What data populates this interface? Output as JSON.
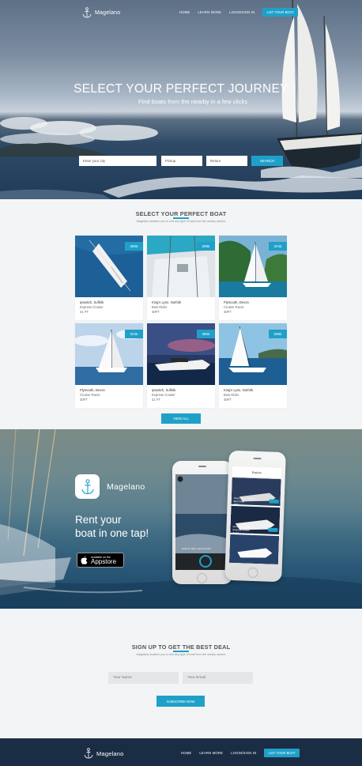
{
  "brand": {
    "name": "Magelano"
  },
  "nav": {
    "links": [
      "HOME",
      "LEARN MORE",
      "LOGIN/SIGN IN"
    ],
    "cta": "LIST YOUR BOAT"
  },
  "hero": {
    "title": "SELECT YOUR PERFECT JOURNEY",
    "subtitle": "Find boats from the nearby in a few clicks",
    "search": {
      "city_placeholder": "Enter your city",
      "pickup_placeholder": "Pickup",
      "return_placeholder": "Return",
      "button": "SEARCH"
    }
  },
  "boats_section": {
    "title": "SELECT YOUR PERFECT BOAT",
    "subtitle": "Magelano enables you to rent any type of boat from the nearby owners",
    "cards": [
      {
        "price": "450£",
        "location": "Ipswitch, Suffolk",
        "type": "Express Cruiser",
        "length": "31 FT"
      },
      {
        "price": "299£",
        "location": "King's Lynn, Norfolk",
        "type": "Bow Rider",
        "length": "30FT"
      },
      {
        "price": "224£",
        "location": "Plymouth, Devon",
        "type": "Cruiser Racer",
        "length": "30FT"
      },
      {
        "price": "224£",
        "location": "Plymouth, Devon",
        "type": "Cruiser Racer",
        "length": "30FT"
      },
      {
        "price": "450£",
        "location": "Ipswitch, Suffolk",
        "type": "Express Cruiser",
        "length": "31 FT"
      },
      {
        "price": "299£",
        "location": "King's Lynn, Norfolk",
        "type": "Bow Rider",
        "length": "30FT"
      }
    ],
    "view_all": "VIEW ALL"
  },
  "app_section": {
    "app_name": "Magelano",
    "line1": "Rent your",
    "line2": "boat in one tap!",
    "appstore_small": "Available on the",
    "appstore_big": "Appstore",
    "phone_screen_title": "Explore",
    "phone_hint": "Hold for video, tap for photo",
    "phone_items": [
      {
        "location": "King's Lynn, Norfolk",
        "type": "Bow Rider",
        "length": "30FT"
      },
      {
        "location": "Ipswitch, Suffolk",
        "type": "Express Cruiser",
        "length": "31 FT"
      }
    ]
  },
  "signup": {
    "title": "SIGN UP TO GET THE BEST DEAL",
    "subtitle": "Magelano enables you to rent any type of boat from the nearby owners",
    "name_placeholder": "Your Name",
    "email_placeholder": "Your Email",
    "button": "SUBSCRIBE NOW"
  },
  "footer": {
    "links": [
      "HOME",
      "LEARN MORE",
      "LOGIN/SIGN IN"
    ],
    "cta": "LIST YOUR BOAT"
  },
  "colors": {
    "accent": "#1fa0c9",
    "footer": "#1b2d45",
    "page_bg": "#f2f4f6"
  }
}
